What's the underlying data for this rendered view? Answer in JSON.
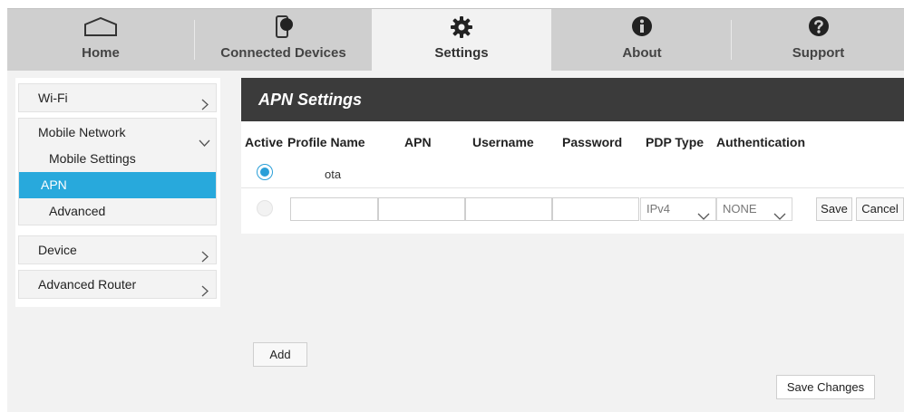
{
  "nav": {
    "tabs": [
      {
        "id": "home",
        "label": "Home",
        "icon": "home-icon"
      },
      {
        "id": "devices",
        "label": "Connected Devices",
        "icon": "phone-device-icon"
      },
      {
        "id": "settings",
        "label": "Settings",
        "icon": "gear-icon",
        "active": true
      },
      {
        "id": "about",
        "label": "About",
        "icon": "info-icon"
      },
      {
        "id": "support",
        "label": "Support",
        "icon": "question-icon"
      }
    ]
  },
  "sidebar": {
    "wifi": "Wi-Fi",
    "mobile_network": {
      "label": "Mobile Network",
      "items": [
        "Mobile Settings",
        "APN",
        "Advanced"
      ],
      "active": "APN"
    },
    "device": "Device",
    "advanced_router": "Advanced Router"
  },
  "content": {
    "title": "APN Settings",
    "columns": {
      "active": "Active",
      "profile_name": "Profile Name",
      "apn": "APN",
      "username": "Username",
      "password": "Password",
      "pdp_type": "PDP Type",
      "authentication": "Authentication"
    },
    "rows": [
      {
        "active": true,
        "profile_name": "ota"
      }
    ],
    "new_row": {
      "pdp_type": "IPv4",
      "authentication": "NONE",
      "save": "Save",
      "cancel": "Cancel"
    },
    "add_button": "Add",
    "save_changes_button": "Save Changes"
  },
  "colors": {
    "accent": "#28a9dc",
    "header_bg": "#3b3b3b",
    "nav_bg": "#cfcfcf"
  }
}
